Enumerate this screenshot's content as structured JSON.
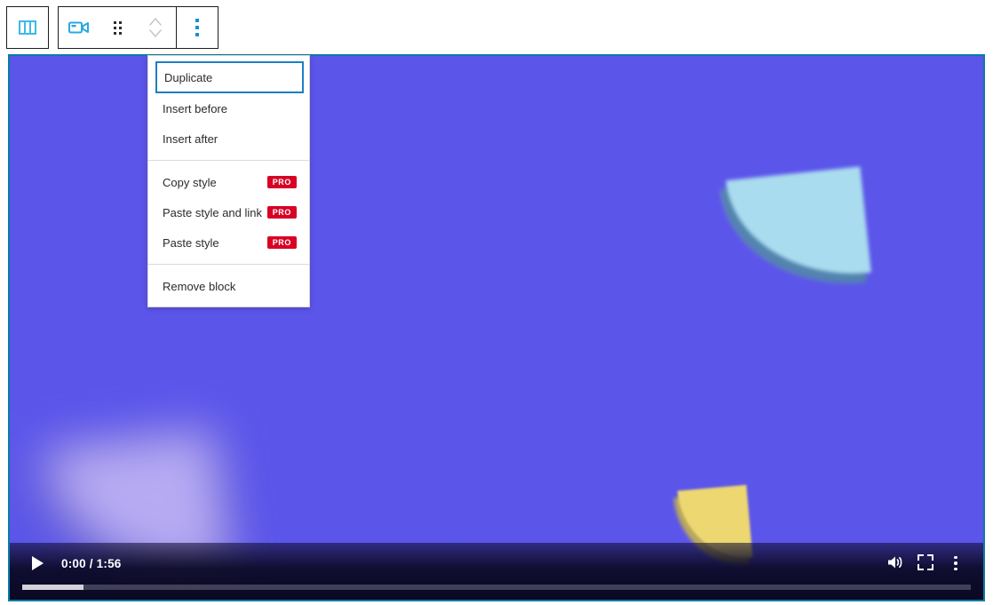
{
  "toolbar": {
    "group1": [
      {
        "name": "columns-layout",
        "icon": "columns-icon",
        "label": "Columns"
      }
    ],
    "group2": [
      {
        "name": "video-block",
        "icon": "video-camera-icon",
        "label": "Video"
      },
      {
        "name": "drag-handle",
        "icon": "drag-handle-icon",
        "label": "Drag"
      },
      {
        "name": "move-updown",
        "icon": "chevron-up-down-icon",
        "label": "Move up or down"
      }
    ],
    "group3": [
      {
        "name": "more-options",
        "icon": "vertical-ellipsis-icon",
        "label": "Options"
      }
    ]
  },
  "menu": {
    "sections": [
      {
        "items": [
          {
            "label": "Duplicate",
            "focused": true,
            "pro": false
          },
          {
            "label": "Insert before",
            "focused": false,
            "pro": false
          },
          {
            "label": "Insert after",
            "focused": false,
            "pro": false
          }
        ]
      },
      {
        "items": [
          {
            "label": "Copy style",
            "focused": false,
            "pro": true
          },
          {
            "label": "Paste style and link",
            "focused": false,
            "pro": true
          },
          {
            "label": "Paste style",
            "focused": false,
            "pro": true
          }
        ]
      },
      {
        "items": [
          {
            "label": "Remove block",
            "focused": false,
            "pro": false
          }
        ]
      }
    ],
    "pro_badge_label": "PRO",
    "pro_badge_color": "#d80024",
    "focus_ring_color": "#1d7fc4"
  },
  "player": {
    "play_label": "Play",
    "current_time": "0:00",
    "duration": "1:56",
    "time_display": "0:00 / 1:56",
    "volume_label": "Mute",
    "fullscreen_label": "Full screen",
    "more_label": "More options",
    "progress_percent": 6.5
  },
  "video": {
    "background_color": "#5b55ea",
    "selection_border_color": "#0b7ba6",
    "shapes": [
      {
        "name": "blue-petal",
        "color": "#a9dcee"
      },
      {
        "name": "yellow-petal",
        "color": "#ecd771"
      },
      {
        "name": "purple-petal-blurred",
        "color": "#b7abf3"
      }
    ]
  }
}
